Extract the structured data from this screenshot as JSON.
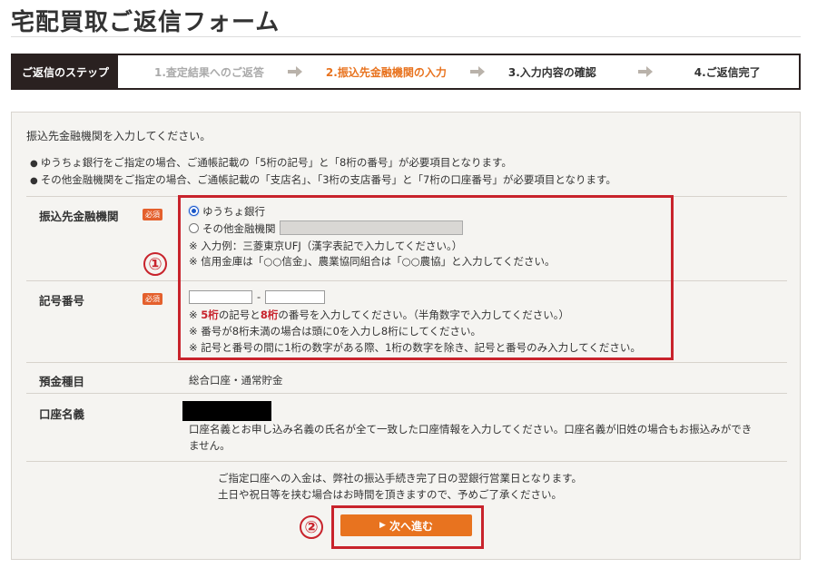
{
  "page_title": "宅配買取ご返信フォーム",
  "steps": {
    "header": "ご返信のステップ",
    "items": [
      "1.査定結果へのご返答",
      "2.振込先金融機関の入力",
      "3.入力内容の確認",
      "4.ご返信完了"
    ]
  },
  "intro": "振込先金融機関を入力してください。",
  "notes": [
    "ゆうちょ銀行をご指定の場合、ご通帳記載の「5桁の記号」と「8桁の番号」が必要項目となります。",
    "その他金融機関をご指定の場合、ご通帳記載の「支店名」、「3桁の支店番号」と「7桁の口座番号」が必要項目となります。"
  ],
  "required_badge": "必須",
  "bank": {
    "label": "振込先金融機関",
    "option_yucho": "ゆうちょ銀行",
    "option_other": "その他金融機関",
    "hint1": "※ 入力例：三菱東京UFJ（漢字表記で入力してください。）",
    "hint2": "※ 信用金庫は「○○信金」、農業協同組合は「○○農協」と入力してください。"
  },
  "code": {
    "label": "記号番号",
    "dash": "-",
    "hint1_prefix": "※ ",
    "hint1_red1": "5桁",
    "hint1_mid": "の記号と",
    "hint1_red2": "8桁",
    "hint1_suffix": "の番号を入力してください。（半角数字で入力してください。）",
    "hint2": "※ 番号が8桁未満の場合は頭に0を入力し8桁にしてください。",
    "hint3": "※ 記号と番号の間に1桁の数字がある際、1桁の数字を除き、記号と番号のみ入力してください。"
  },
  "deposit": {
    "label": "預金種目",
    "value": "総合口座・通常貯金"
  },
  "holder": {
    "label": "口座名義",
    "note_line1": "口座名義とお申し込み名義の氏名が全て一致した口座情報を入力してください。口座名義が旧姓の場合もお振込みができ",
    "note_line2": "ません。"
  },
  "footer_note_line1": "ご指定口座への入金は、弊社の振込手続き完了日の翌銀行営業日となります。",
  "footer_note_line2": "土日や祝日等を挟む場合はお時間を頂きますので、予めご了承ください。",
  "next_button": "次へ進む",
  "annotations": [
    "①",
    "②"
  ],
  "colors": {
    "accent": "#e8731f",
    "highlight_border": "#c8232c",
    "step_header_bg": "#2a2120",
    "required_badge": "#e4602d"
  }
}
